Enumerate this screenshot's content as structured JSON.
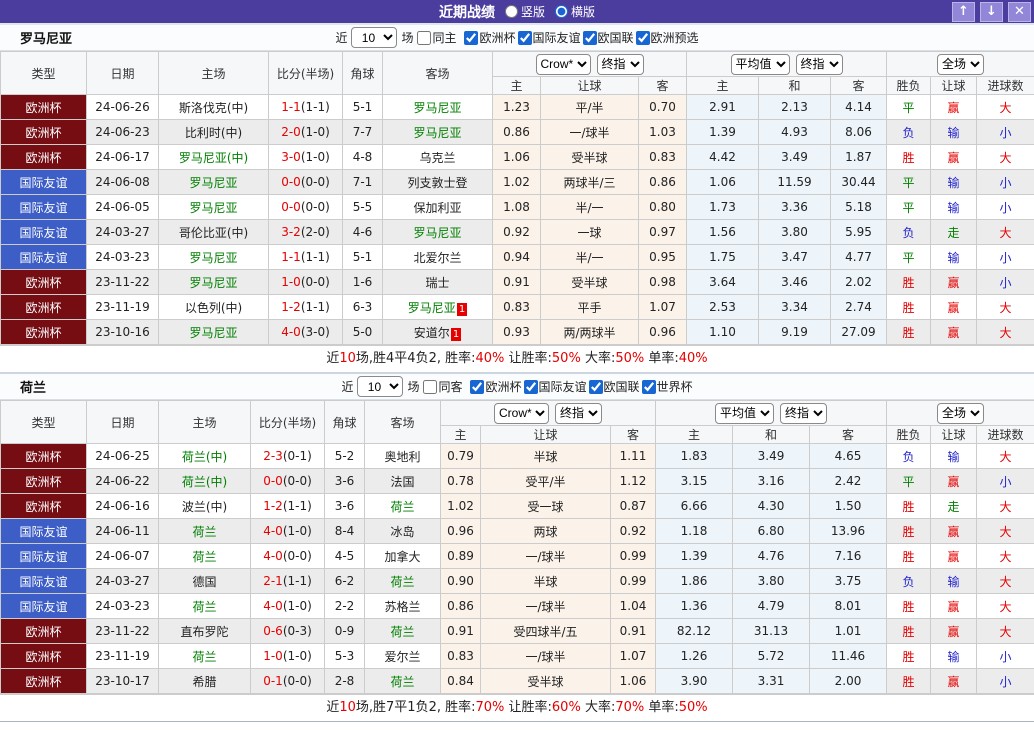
{
  "titlebar": {
    "title": "近期战绩",
    "layout_options": [
      {
        "label": "竖版",
        "selected": false
      },
      {
        "label": "横版",
        "selected": true
      }
    ],
    "buttons": {
      "up": "↑",
      "down": "↓",
      "close": "✕"
    }
  },
  "table_headers": {
    "type": "类型",
    "date": "日期",
    "home": "主场",
    "score": "比分(半场)",
    "corner": "角球",
    "away": "客场",
    "asia": [
      "主",
      "让球",
      "客"
    ],
    "euro": [
      "主",
      "和",
      "客"
    ],
    "result": [
      "胜负",
      "让球",
      "进球数"
    ],
    "selects": {
      "asia_provider": "Crow*",
      "asia_time": "终指",
      "euro_provider": "平均值",
      "euro_time": "终指",
      "scope": "全场"
    }
  },
  "colors": {
    "accent": "#4b3d9e",
    "checkbox_blue": "#1766d2",
    "self_team_green": "#008000",
    "score_red": "#e60000",
    "type": {
      "欧洲杯": "#750d13",
      "国际友谊": "#3c5ec6"
    },
    "result": {
      "胜": "#e60000",
      "平": "#008000",
      "负": "#2222cc",
      "赢": "#e60000",
      "走": "#008000",
      "输": "#2222cc",
      "大": "#e60000",
      "小": "#2222cc"
    }
  },
  "tables": [
    {
      "team": "罗马尼亚",
      "filters": {
        "recent_label": "近",
        "count": "10",
        "unit": "场",
        "same_label": "同主",
        "same_checked": false,
        "comps": [
          {
            "label": "欧洲杯",
            "checked": true
          },
          {
            "label": "国际友谊",
            "checked": true
          },
          {
            "label": "欧国联",
            "checked": true
          },
          {
            "label": "欧洲预选",
            "checked": true
          }
        ]
      },
      "rows": [
        {
          "type": "欧洲杯",
          "date": "24-06-26",
          "home": {
            "name": "斯洛伐克(中)",
            "self": false
          },
          "score": "1-1",
          "half": "(1-1)",
          "corner": "5-1",
          "away": {
            "name": "罗马尼亚",
            "self": true
          },
          "asia": [
            "1.23",
            "平/半",
            "0.70"
          ],
          "euro": [
            "2.91",
            "2.13",
            "4.14"
          ],
          "result": [
            "平",
            "赢",
            "大"
          ]
        },
        {
          "type": "欧洲杯",
          "date": "24-06-23",
          "home": {
            "name": "比利时(中)",
            "self": false
          },
          "score": "2-0",
          "half": "(1-0)",
          "corner": "7-7",
          "away": {
            "name": "罗马尼亚",
            "self": true
          },
          "asia": [
            "0.86",
            "一/球半",
            "1.03"
          ],
          "euro": [
            "1.39",
            "4.93",
            "8.06"
          ],
          "result": [
            "负",
            "输",
            "小"
          ]
        },
        {
          "type": "欧洲杯",
          "date": "24-06-17",
          "home": {
            "name": "罗马尼亚(中)",
            "self": true
          },
          "score": "3-0",
          "half": "(1-0)",
          "corner": "4-8",
          "away": {
            "name": "乌克兰",
            "self": false
          },
          "asia": [
            "1.06",
            "受半球",
            "0.83"
          ],
          "euro": [
            "4.42",
            "3.49",
            "1.87"
          ],
          "result": [
            "胜",
            "赢",
            "大"
          ]
        },
        {
          "type": "国际友谊",
          "date": "24-06-08",
          "home": {
            "name": "罗马尼亚",
            "self": true
          },
          "score": "0-0",
          "half": "(0-0)",
          "corner": "7-1",
          "away": {
            "name": "列支敦士登",
            "self": false
          },
          "asia": [
            "1.02",
            "两球半/三",
            "0.86"
          ],
          "euro": [
            "1.06",
            "11.59",
            "30.44"
          ],
          "result": [
            "平",
            "输",
            "小"
          ]
        },
        {
          "type": "国际友谊",
          "date": "24-06-05",
          "home": {
            "name": "罗马尼亚",
            "self": true
          },
          "score": "0-0",
          "half": "(0-0)",
          "corner": "5-5",
          "away": {
            "name": "保加利亚",
            "self": false
          },
          "asia": [
            "1.08",
            "半/一",
            "0.80"
          ],
          "euro": [
            "1.73",
            "3.36",
            "5.18"
          ],
          "result": [
            "平",
            "输",
            "小"
          ]
        },
        {
          "type": "国际友谊",
          "date": "24-03-27",
          "home": {
            "name": "哥伦比亚(中)",
            "self": false
          },
          "score": "3-2",
          "half": "(2-0)",
          "corner": "4-6",
          "away": {
            "name": "罗马尼亚",
            "self": true
          },
          "asia": [
            "0.92",
            "一球",
            "0.97"
          ],
          "euro": [
            "1.56",
            "3.80",
            "5.95"
          ],
          "result": [
            "负",
            "走",
            "大"
          ]
        },
        {
          "type": "国际友谊",
          "date": "24-03-23",
          "home": {
            "name": "罗马尼亚",
            "self": true
          },
          "score": "1-1",
          "half": "(1-1)",
          "corner": "5-1",
          "away": {
            "name": "北爱尔兰",
            "self": false
          },
          "asia": [
            "0.94",
            "半/一",
            "0.95"
          ],
          "euro": [
            "1.75",
            "3.47",
            "4.77"
          ],
          "result": [
            "平",
            "输",
            "小"
          ]
        },
        {
          "type": "欧洲杯",
          "date": "23-11-22",
          "home": {
            "name": "罗马尼亚",
            "self": true
          },
          "score": "1-0",
          "half": "(0-0)",
          "corner": "1-6",
          "away": {
            "name": "瑞士",
            "self": false
          },
          "asia": [
            "0.91",
            "受半球",
            "0.98"
          ],
          "euro": [
            "3.64",
            "3.46",
            "2.02"
          ],
          "result": [
            "胜",
            "赢",
            "小"
          ]
        },
        {
          "type": "欧洲杯",
          "date": "23-11-19",
          "home": {
            "name": "以色列(中)",
            "self": false
          },
          "score": "1-2",
          "half": "(1-1)",
          "corner": "6-3",
          "away": {
            "name": "罗马尼亚",
            "self": true,
            "badge": "1"
          },
          "asia": [
            "0.83",
            "平手",
            "1.07"
          ],
          "euro": [
            "2.53",
            "3.34",
            "2.74"
          ],
          "result": [
            "胜",
            "赢",
            "大"
          ]
        },
        {
          "type": "欧洲杯",
          "date": "23-10-16",
          "home": {
            "name": "罗马尼亚",
            "self": true
          },
          "score": "4-0",
          "half": "(3-0)",
          "corner": "5-0",
          "away": {
            "name": "安道尔",
            "self": false,
            "badge": "1"
          },
          "asia": [
            "0.93",
            "两/两球半",
            "0.96"
          ],
          "euro": [
            "1.10",
            "9.19",
            "27.09"
          ],
          "result": [
            "胜",
            "赢",
            "大"
          ]
        }
      ],
      "summary": [
        {
          "t": "近"
        },
        {
          "t": "10",
          "red": true
        },
        {
          "t": "场,胜4平4负2, 胜率:"
        },
        {
          "t": "40%",
          "red": true
        },
        {
          "t": " 让胜率:"
        },
        {
          "t": "50%",
          "red": true
        },
        {
          "t": " 大率:"
        },
        {
          "t": "50%",
          "red": true
        },
        {
          "t": " 单率:"
        },
        {
          "t": "40%",
          "red": true
        }
      ]
    },
    {
      "team": "荷兰",
      "filters": {
        "recent_label": "近",
        "count": "10",
        "unit": "场",
        "same_label": "同客",
        "same_checked": false,
        "comps": [
          {
            "label": "欧洲杯",
            "checked": true
          },
          {
            "label": "国际友谊",
            "checked": true
          },
          {
            "label": "欧国联",
            "checked": true
          },
          {
            "label": "世界杯",
            "checked": true
          }
        ]
      },
      "rows": [
        {
          "type": "欧洲杯",
          "date": "24-06-25",
          "home": {
            "name": "荷兰(中)",
            "self": true
          },
          "score": "2-3",
          "half": "(0-1)",
          "corner": "5-2",
          "away": {
            "name": "奥地利",
            "self": false
          },
          "asia": [
            "0.79",
            "半球",
            "1.11"
          ],
          "euro": [
            "1.83",
            "3.49",
            "4.65"
          ],
          "result": [
            "负",
            "输",
            "大"
          ]
        },
        {
          "type": "欧洲杯",
          "date": "24-06-22",
          "home": {
            "name": "荷兰(中)",
            "self": true
          },
          "score": "0-0",
          "half": "(0-0)",
          "corner": "3-6",
          "away": {
            "name": "法国",
            "self": false
          },
          "asia": [
            "0.78",
            "受平/半",
            "1.12"
          ],
          "euro": [
            "3.15",
            "3.16",
            "2.42"
          ],
          "result": [
            "平",
            "赢",
            "小"
          ]
        },
        {
          "type": "欧洲杯",
          "date": "24-06-16",
          "home": {
            "name": "波兰(中)",
            "self": false
          },
          "score": "1-2",
          "half": "(1-1)",
          "corner": "3-6",
          "away": {
            "name": "荷兰",
            "self": true
          },
          "asia": [
            "1.02",
            "受一球",
            "0.87"
          ],
          "euro": [
            "6.66",
            "4.30",
            "1.50"
          ],
          "result": [
            "胜",
            "走",
            "大"
          ]
        },
        {
          "type": "国际友谊",
          "date": "24-06-11",
          "home": {
            "name": "荷兰",
            "self": true
          },
          "score": "4-0",
          "half": "(1-0)",
          "corner": "8-4",
          "away": {
            "name": "冰岛",
            "self": false
          },
          "asia": [
            "0.96",
            "两球",
            "0.92"
          ],
          "euro": [
            "1.18",
            "6.80",
            "13.96"
          ],
          "result": [
            "胜",
            "赢",
            "大"
          ]
        },
        {
          "type": "国际友谊",
          "date": "24-06-07",
          "home": {
            "name": "荷兰",
            "self": true
          },
          "score": "4-0",
          "half": "(0-0)",
          "corner": "4-5",
          "away": {
            "name": "加拿大",
            "self": false
          },
          "asia": [
            "0.89",
            "一/球半",
            "0.99"
          ],
          "euro": [
            "1.39",
            "4.76",
            "7.16"
          ],
          "result": [
            "胜",
            "赢",
            "大"
          ]
        },
        {
          "type": "国际友谊",
          "date": "24-03-27",
          "home": {
            "name": "德国",
            "self": false
          },
          "score": "2-1",
          "half": "(1-1)",
          "corner": "6-2",
          "away": {
            "name": "荷兰",
            "self": true
          },
          "asia": [
            "0.90",
            "半球",
            "0.99"
          ],
          "euro": [
            "1.86",
            "3.80",
            "3.75"
          ],
          "result": [
            "负",
            "输",
            "大"
          ]
        },
        {
          "type": "国际友谊",
          "date": "24-03-23",
          "home": {
            "name": "荷兰",
            "self": true
          },
          "score": "4-0",
          "half": "(1-0)",
          "corner": "2-2",
          "away": {
            "name": "苏格兰",
            "self": false
          },
          "asia": [
            "0.86",
            "一/球半",
            "1.04"
          ],
          "euro": [
            "1.36",
            "4.79",
            "8.01"
          ],
          "result": [
            "胜",
            "赢",
            "大"
          ]
        },
        {
          "type": "欧洲杯",
          "date": "23-11-22",
          "home": {
            "name": "直布罗陀",
            "self": false
          },
          "score": "0-6",
          "half": "(0-3)",
          "corner": "0-9",
          "away": {
            "name": "荷兰",
            "self": true
          },
          "asia": [
            "0.91",
            "受四球半/五",
            "0.91"
          ],
          "euro": [
            "82.12",
            "31.13",
            "1.01"
          ],
          "result": [
            "胜",
            "赢",
            "大"
          ]
        },
        {
          "type": "欧洲杯",
          "date": "23-11-19",
          "home": {
            "name": "荷兰",
            "self": true
          },
          "score": "1-0",
          "half": "(1-0)",
          "corner": "5-3",
          "away": {
            "name": "爱尔兰",
            "self": false
          },
          "asia": [
            "0.83",
            "一/球半",
            "1.07"
          ],
          "euro": [
            "1.26",
            "5.72",
            "11.46"
          ],
          "result": [
            "胜",
            "输",
            "小"
          ]
        },
        {
          "type": "欧洲杯",
          "date": "23-10-17",
          "home": {
            "name": "希腊",
            "self": false
          },
          "score": "0-1",
          "half": "(0-0)",
          "corner": "2-8",
          "away": {
            "name": "荷兰",
            "self": true
          },
          "asia": [
            "0.84",
            "受半球",
            "1.06"
          ],
          "euro": [
            "3.90",
            "3.31",
            "2.00"
          ],
          "result": [
            "胜",
            "赢",
            "小"
          ]
        }
      ],
      "summary": [
        {
          "t": "近"
        },
        {
          "t": "10",
          "red": true
        },
        {
          "t": "场,胜7平1负2, 胜率:"
        },
        {
          "t": "70%",
          "red": true
        },
        {
          "t": " 让胜率:"
        },
        {
          "t": "60%",
          "red": true
        },
        {
          "t": " 大率:"
        },
        {
          "t": "70%",
          "red": true
        },
        {
          "t": " 单率:"
        },
        {
          "t": "50%",
          "red": true
        }
      ]
    }
  ]
}
